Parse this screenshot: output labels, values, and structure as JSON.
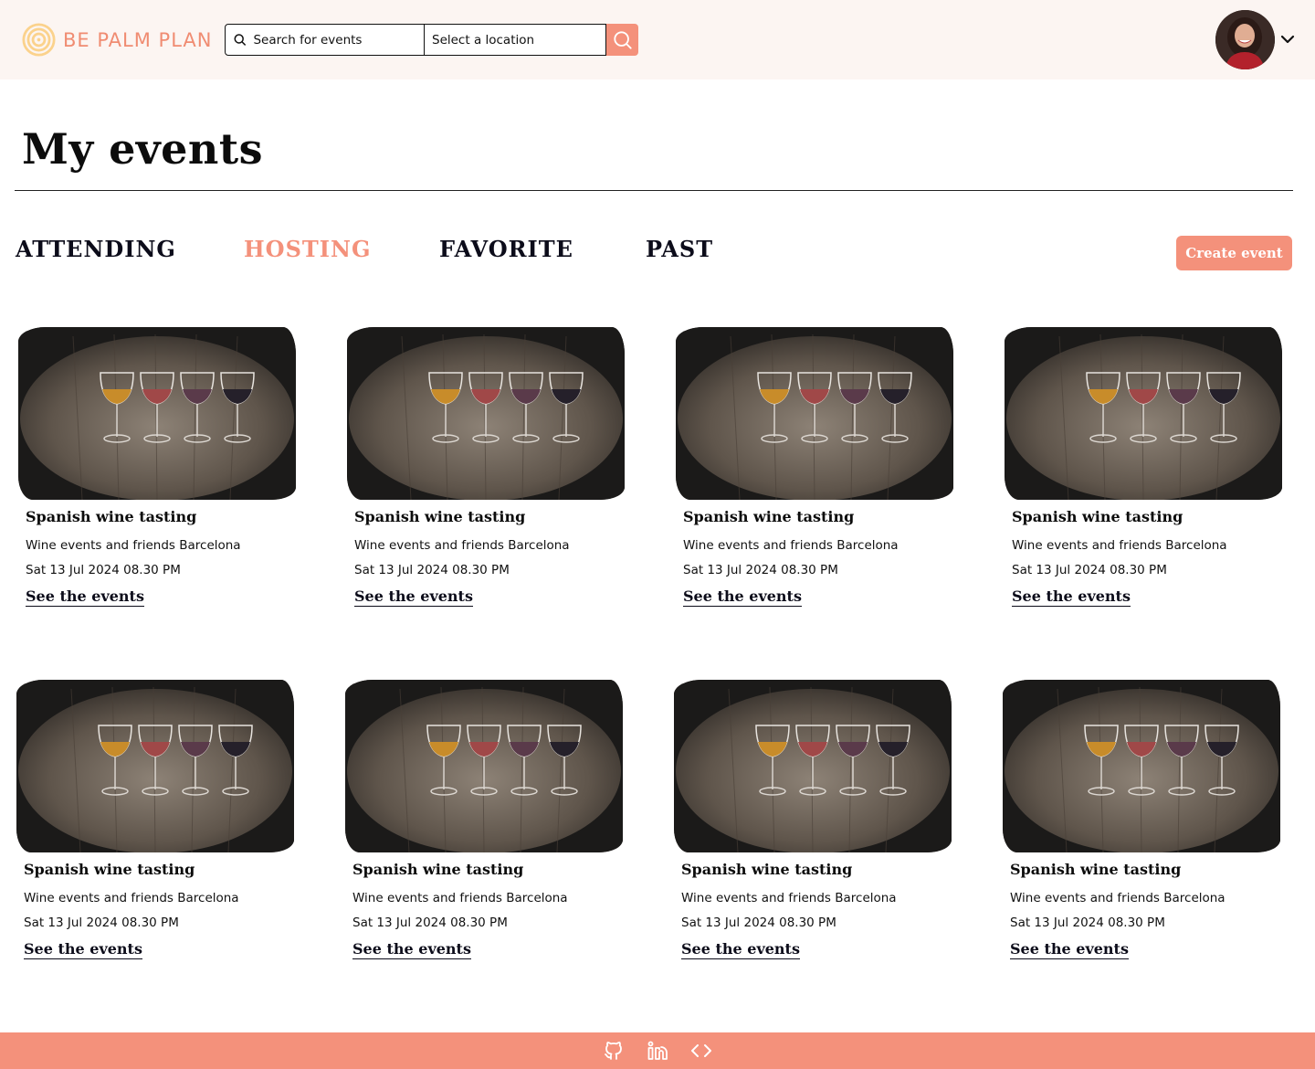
{
  "header": {
    "logo_text": "BE PALM PLAN",
    "search_placeholder": "Search for events",
    "location_placeholder": "Select a location"
  },
  "page": {
    "title": "My events"
  },
  "tabs": [
    {
      "label": "ATTENDING",
      "active": false
    },
    {
      "label": "HOSTING",
      "active": true
    },
    {
      "label": "FAVORITE",
      "active": false
    },
    {
      "label": "PAST",
      "active": false
    }
  ],
  "create_button_label": "Create event",
  "events": [
    {
      "title": "Spanish wine tasting",
      "organizer": "Wine events and friends Barcelona",
      "date": "Sat 13 Jul 2024 08.30 PM",
      "link": "See the events"
    },
    {
      "title": "Spanish wine tasting",
      "organizer": "Wine events and friends Barcelona",
      "date": "Sat 13 Jul 2024 08.30 PM",
      "link": "See the events"
    },
    {
      "title": "Spanish wine tasting",
      "organizer": "Wine events and friends Barcelona",
      "date": "Sat 13 Jul 2024 08.30 PM",
      "link": "See the events"
    },
    {
      "title": "Spanish wine tasting",
      "organizer": "Wine events and friends Barcelona",
      "date": "Sat 13 Jul 2024 08.30 PM",
      "link": "See the events"
    },
    {
      "title": "Spanish wine tasting",
      "organizer": "Wine events and friends Barcelona",
      "date": "Sat 13 Jul 2024 08.30 PM",
      "link": "See the events"
    },
    {
      "title": "Spanish wine tasting",
      "organizer": "Wine events and friends Barcelona",
      "date": "Sat 13 Jul 2024 08.30 PM",
      "link": "See the events"
    },
    {
      "title": "Spanish wine tasting",
      "organizer": "Wine events and friends Barcelona",
      "date": "Sat 13 Jul 2024 08.30 PM",
      "link": "See the events"
    },
    {
      "title": "Spanish wine tasting",
      "organizer": "Wine events and friends Barcelona",
      "date": "Sat 13 Jul 2024 08.30 PM",
      "link": "See the events"
    }
  ],
  "footer": {
    "icons": [
      "github-icon",
      "linkedin-icon",
      "code-icon"
    ]
  },
  "colors": {
    "accent": "#f4917b",
    "header_bg": "#fcf5f2",
    "logo": "#f08c72",
    "text": "#0c0c0c"
  }
}
